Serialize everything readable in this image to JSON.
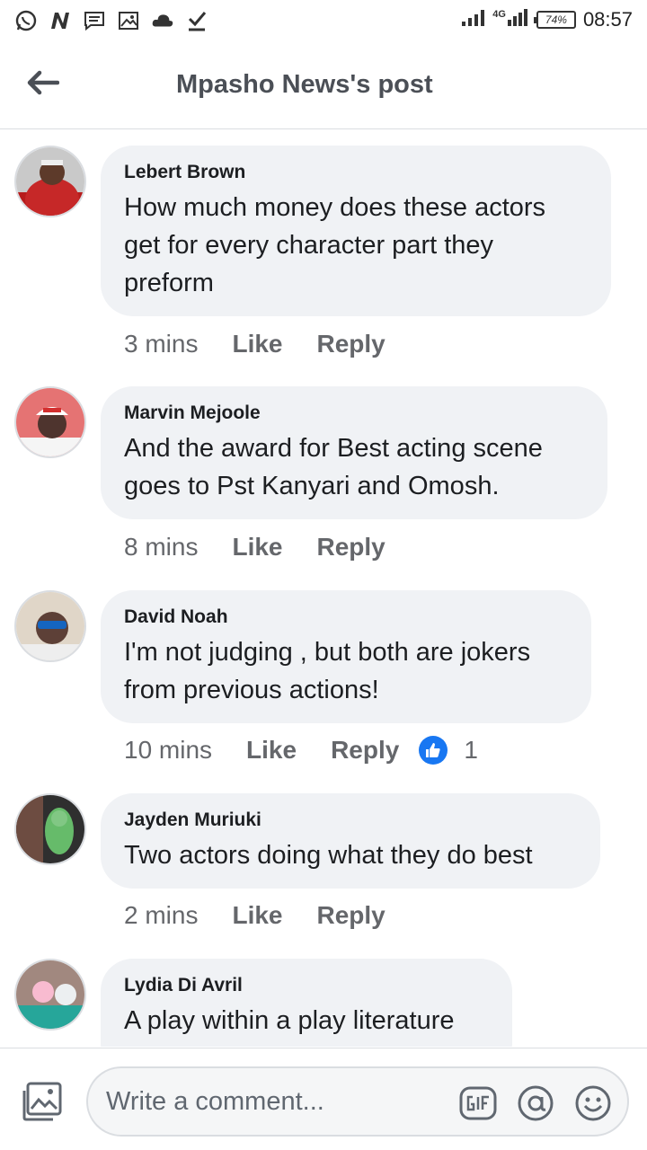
{
  "status_bar": {
    "time": "08:57",
    "battery": "74%",
    "network": "4G",
    "left_icons": [
      "whatsapp-icon",
      "n-app-icon",
      "message-icon",
      "gallery-icon",
      "cloud-icon",
      "download-done-icon"
    ]
  },
  "header": {
    "title": "Mpasho News's post"
  },
  "comments": [
    {
      "author": "Lebert Brown",
      "text": "How much money does these actors get for every character part they preform",
      "time": "3 mins",
      "like_label": "Like",
      "reply_label": "Reply"
    },
    {
      "author": "Marvin Mejoole",
      "text": "And the award for Best acting scene goes to Pst Kanyari and Omosh.",
      "time": "8 mins",
      "like_label": "Like",
      "reply_label": "Reply"
    },
    {
      "author": "David Noah",
      "text": "I'm not judging , but both are jokers from previous actions!",
      "time": "10 mins",
      "like_label": "Like",
      "reply_label": "Reply",
      "reaction_count": "1"
    },
    {
      "author": "Jayden Muriuki",
      "text": "Two actors doing what they do best",
      "time": "2 mins",
      "like_label": "Like",
      "reply_label": "Reply"
    },
    {
      "author": "Lydia Di Avril",
      "text": "A play within a play literature"
    }
  ],
  "composer": {
    "placeholder": "Write a comment..."
  },
  "colors": {
    "accent": "#1877f2",
    "bubble": "#f0f2f5",
    "secondary_text": "#65676b"
  }
}
